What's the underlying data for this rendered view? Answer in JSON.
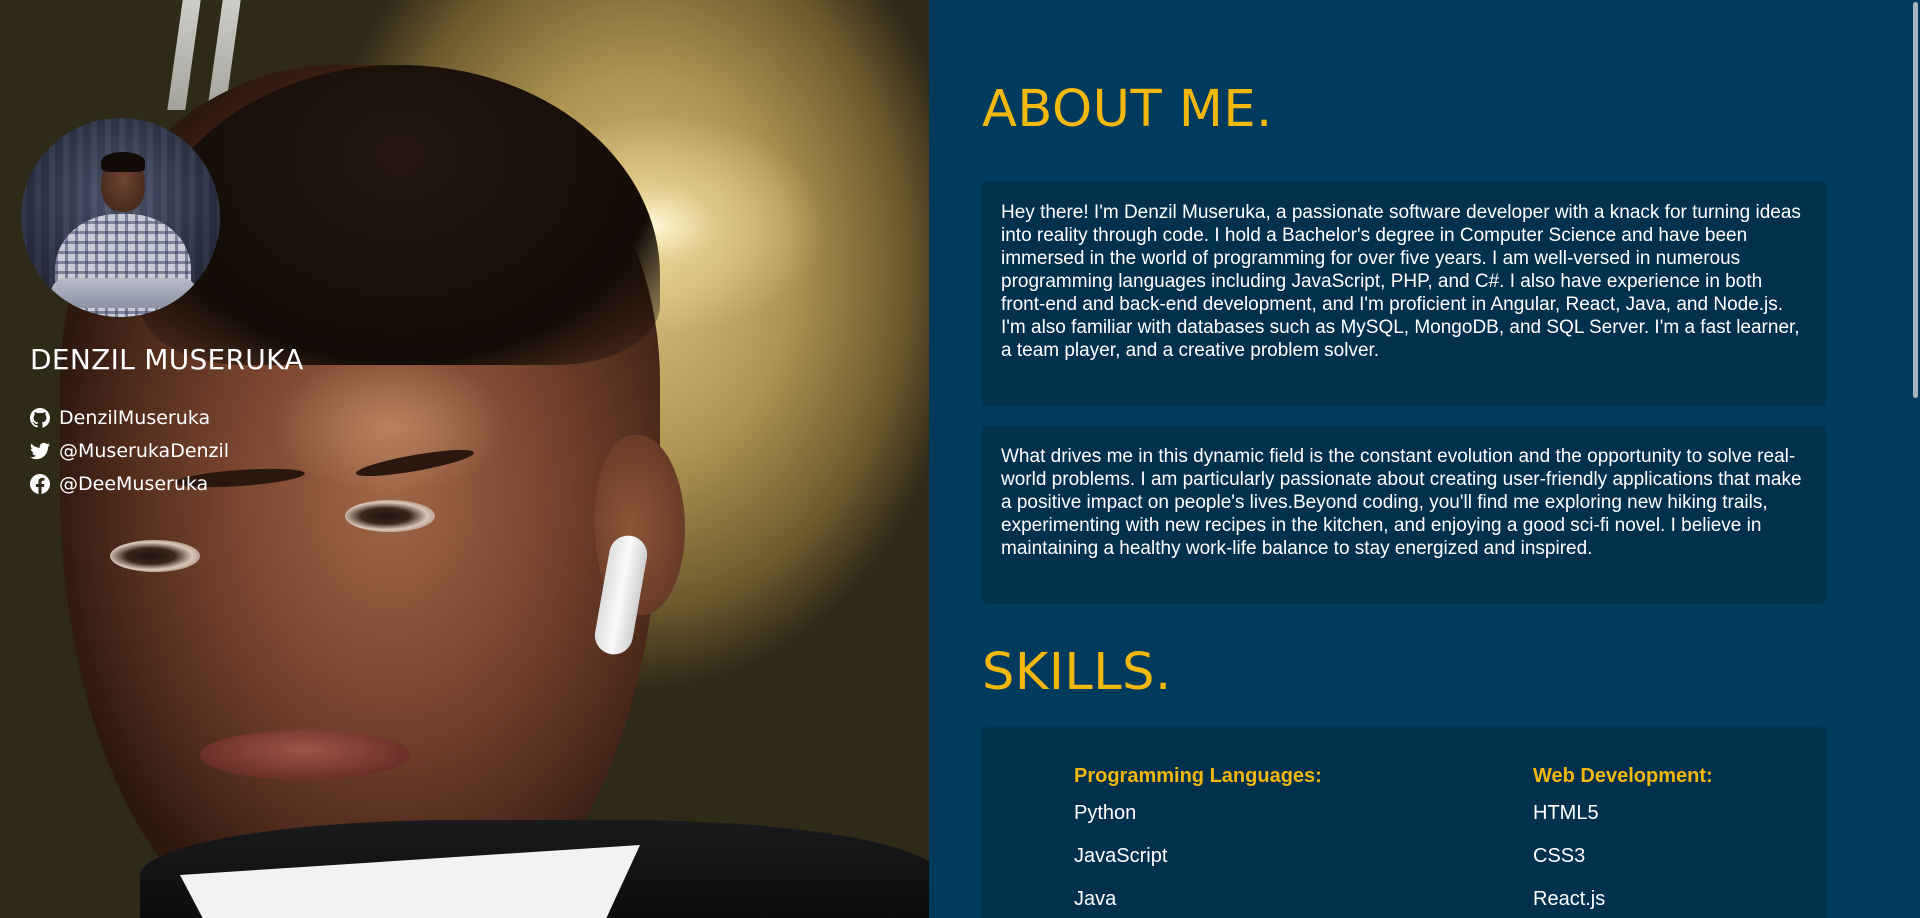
{
  "profile": {
    "name": "DENZIL MUSERUKA",
    "socials": [
      {
        "icon": "github-icon",
        "label": "DenzilMuseruka"
      },
      {
        "icon": "twitter-icon",
        "label": "@MuserukaDenzil"
      },
      {
        "icon": "facebook-icon",
        "label": "@DeeMuseruka"
      }
    ]
  },
  "about": {
    "title": "ABOUT ME.",
    "paragraphs": [
      "Hey there! I'm Denzil Museruka, a passionate software developer with a knack for turning ideas into reality through code. I hold a Bachelor's degree in Computer Science and have been immersed in the world of programming for over five years. I am well-versed in numerous programming languages including JavaScript, PHP, and C#. I also have experience in both front-end and back-end development, and I'm proficient in Angular, React, Java, and Node.js. I'm also familiar with databases such as MySQL, MongoDB, and SQL Server. I'm a fast learner, a team player, and a creative problem solver.",
      "What drives me in this dynamic field is the constant evolution and the opportunity to solve real-world problems. I am particularly passionate about creating user-friendly applications that make a positive impact on people's lives.Beyond coding, you'll find me exploring new hiking trails, experimenting with new recipes in the kitchen, and enjoying a good sci-fi novel. I believe in maintaining a healthy work-life balance to stay energized and inspired."
    ]
  },
  "skills": {
    "title": "SKILLS.",
    "groups": [
      {
        "heading": "Programming Languages:",
        "items": [
          "Python",
          "JavaScript",
          "Java"
        ]
      },
      {
        "heading": "Web Development:",
        "items": [
          "HTML5",
          "CSS3",
          "React.js"
        ]
      }
    ]
  },
  "colors": {
    "accent": "#f3b80d",
    "panel_background": "#003a5c",
    "card_background": "#02304d",
    "text": "#ffffff"
  }
}
